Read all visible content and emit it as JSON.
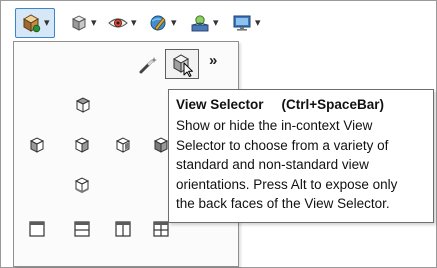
{
  "toolbar": {
    "items": [
      {
        "icon": "view-orientation-icon",
        "has_dropdown": true,
        "active": true
      },
      {
        "icon": "display-style-icon",
        "has_dropdown": true
      },
      {
        "icon": "hide-show-items-icon",
        "has_dropdown": true
      },
      {
        "icon": "edit-appearance-icon",
        "has_dropdown": true
      },
      {
        "icon": "apply-scene-icon",
        "has_dropdown": true
      },
      {
        "icon": "view-settings-icon",
        "has_dropdown": true
      }
    ],
    "dropdown_glyph": "▾"
  },
  "flyout": {
    "more_label": "»",
    "rows": [
      [
        "top-view-icon"
      ],
      [
        "left-view-icon",
        "front-view-icon",
        "right-view-icon",
        "back-view-icon"
      ],
      [
        "bottom-view-icon"
      ],
      [
        "single-view-icon",
        "two-view-horizontal-icon",
        "two-view-vertical-icon",
        "four-view-icon"
      ]
    ]
  },
  "tooltip": {
    "title": "View Selector",
    "shortcut": "(Ctrl+SpaceBar)",
    "lines": [
      "Show or hide the in-context View",
      "Selector to choose from a variety of",
      "standard and non-standard view",
      "orientations. Press Alt to expose only",
      "the back faces of the View Selector."
    ]
  },
  "colors": {
    "active_fill": "#d6e8f7",
    "active_border": "#3b86c6",
    "tooltip_border": "#6e6e6e"
  }
}
